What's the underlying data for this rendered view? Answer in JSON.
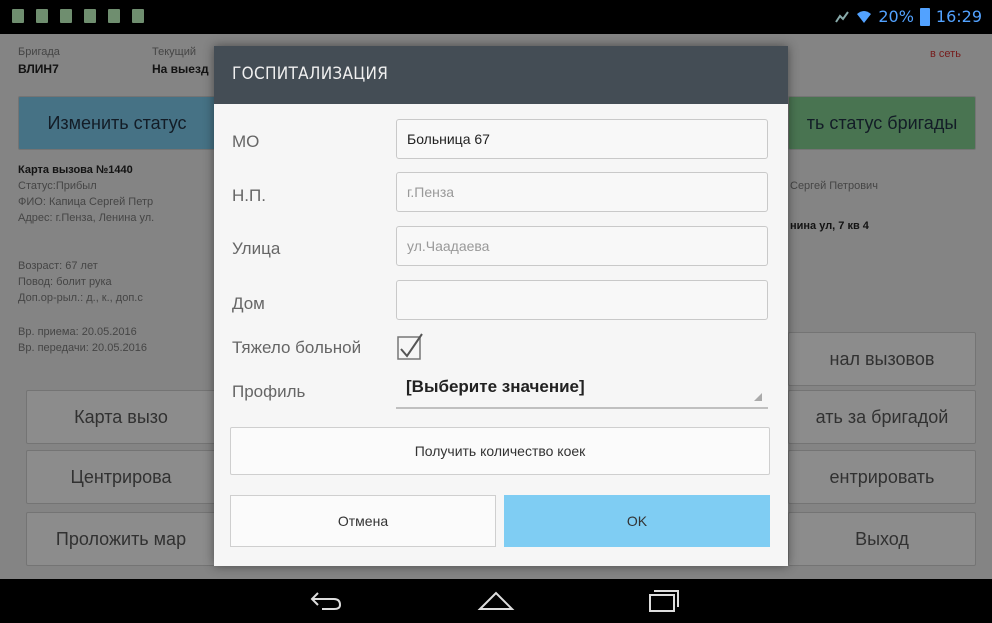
{
  "status_bar": {
    "battery": "20%",
    "time": "16:29",
    "left_icons": [
      "usb-icon",
      "screenshot-icon",
      "menu-icon",
      "warning-icon",
      "download-icon",
      "cat-icon"
    ],
    "colors": {
      "accent": "#52a2ff"
    }
  },
  "background": {
    "brigade_label": "Бригада",
    "brigade_value": "ВЛИН7",
    "current_label": "Текущий",
    "current_value": "На выезд",
    "right_top_text": "в сеть",
    "change_status_left": "Изменить статус",
    "change_status_right": "ть статус бригады",
    "card_title": "Карта вызова №1440",
    "status_line": "Статус:Прибыл",
    "fio_line": "ФИО: Капица Сергей Петр",
    "fio_right": "Сергей Петрович",
    "address_line": "Адрес: г.Пенза, Ленина ул.",
    "address_right": "нина ул, 7 кв 4",
    "age_line": "Возраст: 67 лет",
    "reason_line": "Повод: болит рука",
    "extra_line": "Доп.ор-рыл.: д., к., доп.с",
    "received_line": "Вр. приема: 20.05.2016",
    "sent_line": "Вр. передачи: 20.05.2016",
    "btn_journal": "нал вызовов",
    "btn_card": "Карта вызо",
    "btn_follow": "ать за бригадой",
    "btn_center_left": "Центрирова",
    "btn_center_right": "ентрировать",
    "btn_route": "Проложить мар",
    "btn_exit": "Выход"
  },
  "dialog": {
    "title": "ГОСПИТАЛИЗАЦИЯ",
    "mo_label": "МО",
    "mo_value": "Больница 67",
    "np_label": "Н.П.",
    "np_placeholder": "г.Пенза",
    "street_label": "Улица",
    "street_placeholder": "ул.Чаадаева",
    "house_label": "Дом",
    "house_value": "",
    "heavy_label": "Тяжело больной",
    "heavy_checked": true,
    "profile_label": "Профиль",
    "profile_value": "[Выберите значение]",
    "beds_button": "Получить количество коек",
    "cancel_button": "Отмена",
    "ok_button": "OK",
    "colors": {
      "header": "#444d55",
      "ok": "#7fcdf3"
    }
  },
  "nav": {
    "back_icon": "back-icon",
    "home_icon": "home-icon",
    "recents_icon": "recents-icon"
  }
}
